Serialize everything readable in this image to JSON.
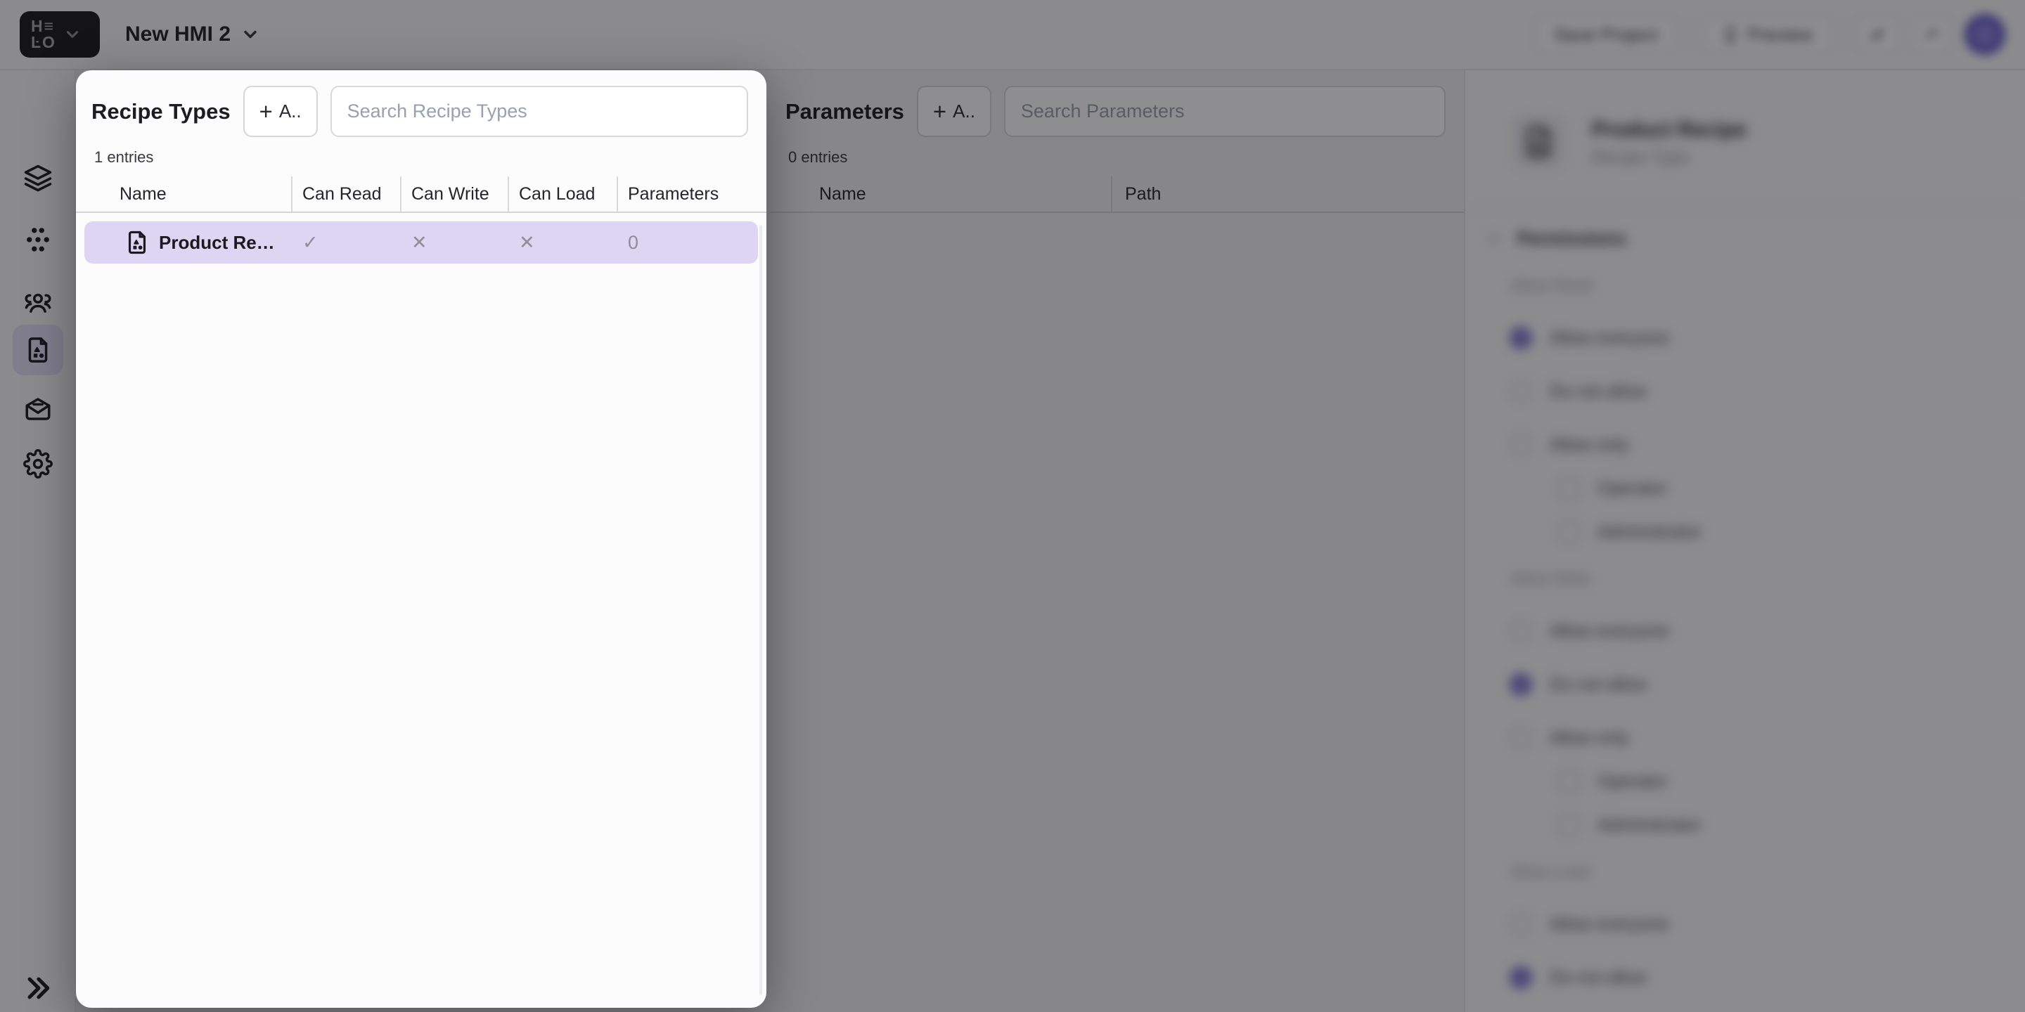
{
  "topbar": {
    "logo_line1": "H≡",
    "logo_line2": "ĿO",
    "project_title": "New HMI 2",
    "save_label": "Save Project",
    "preview_label": "Preview"
  },
  "recipe_types_panel": {
    "title": "Recipe Types",
    "add_plus_glyph": "+",
    "add_label": "A..",
    "search_placeholder": "Search Recipe Types",
    "entries_label": "1 entries",
    "columns": [
      "Name",
      "Can Read",
      "Can Write",
      "Can Load",
      "Parameters"
    ],
    "rows": [
      {
        "name": "Product Re…",
        "can_read": "✓",
        "can_write": "✕",
        "can_load": "✕",
        "parameters": "0"
      }
    ]
  },
  "parameters_panel": {
    "title": "Parameters",
    "add_plus_glyph": "+",
    "add_label": "A..",
    "search_placeholder": "Search Parameters",
    "entries_label": "0 entries",
    "columns": [
      "Name",
      "Path"
    ]
  },
  "details_sidebar": {
    "title": "Product Recipe",
    "subtitle": "Recipe Type",
    "permissions": {
      "section_label": "Permissions",
      "groups": [
        {
          "label": "Allow Read",
          "options": [
            {
              "label": "Allow everyone"
            },
            {
              "label": "Do not allow"
            },
            {
              "label": "Allow only"
            },
            {
              "label": "Operator"
            },
            {
              "label": "Administrator"
            }
          ]
        },
        {
          "label": "Allow Write",
          "options": [
            {
              "label": "Allow everyone"
            },
            {
              "label": "Do not allow"
            },
            {
              "label": "Allow only"
            },
            {
              "label": "Operator"
            },
            {
              "label": "Administrator"
            }
          ]
        },
        {
          "label": "Allow Load",
          "options": [
            {
              "label": "Allow everyone"
            },
            {
              "label": "Do not allow"
            }
          ]
        }
      ]
    }
  },
  "colors": {
    "accent": "#5a50c4",
    "row_highlight": "#dcd6f3",
    "active_nav_bg": "#e4dff9",
    "logo_bg": "#19191d",
    "dim_overlay": "rgba(15,15,19,0.47)"
  }
}
